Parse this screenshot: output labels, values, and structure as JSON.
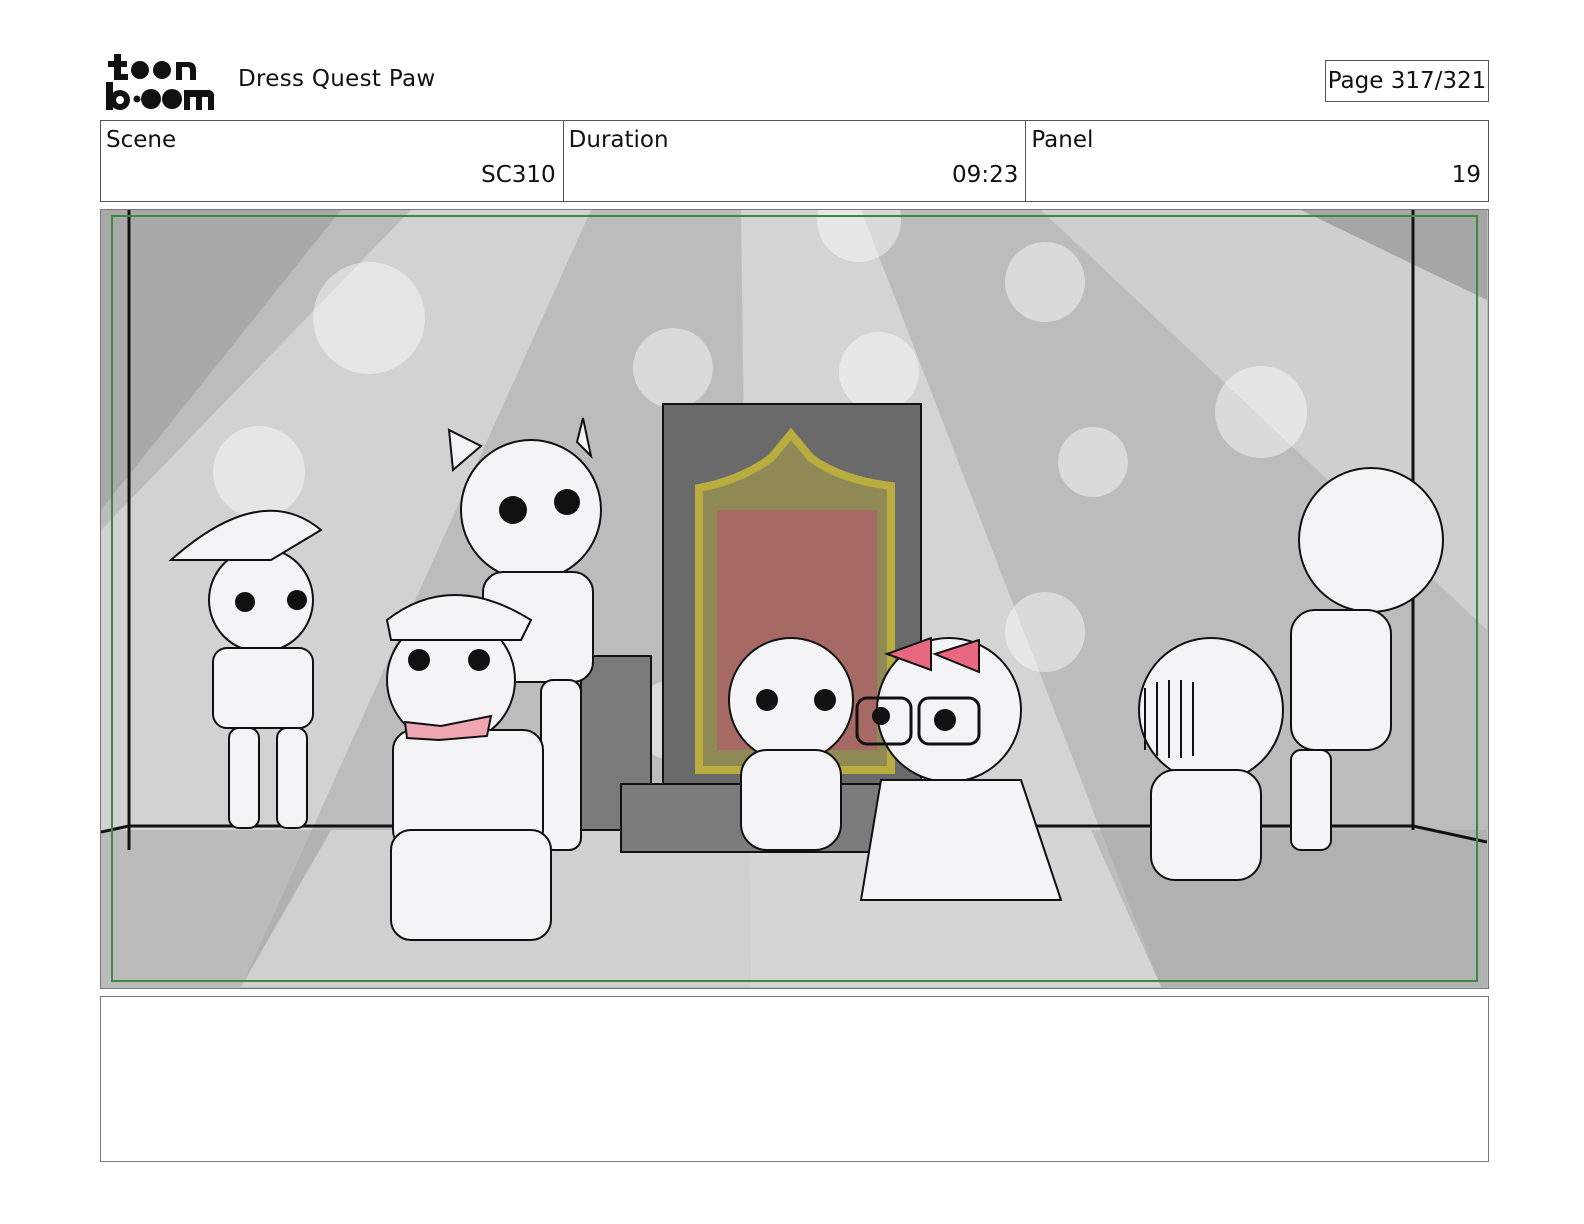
{
  "header": {
    "project_title": "Dress Quest Paw",
    "page_label": "Page 317/321"
  },
  "logo": {
    "text_top": "toon",
    "text_bottom": "boom"
  },
  "info": {
    "scene": {
      "label": "Scene",
      "value": "SC310"
    },
    "duration": {
      "label": "Duration",
      "value": "09:23"
    },
    "panel": {
      "label": "Panel",
      "value": "19"
    }
  },
  "notes": {
    "text": ""
  },
  "colors": {
    "safe_frame": "#3c8a3c",
    "bow_pink": "#e8697f",
    "throne_gold": "#b8ad3e",
    "throne_red": "#c06060"
  },
  "icons": {
    "logo": "toon-boom-logo"
  }
}
